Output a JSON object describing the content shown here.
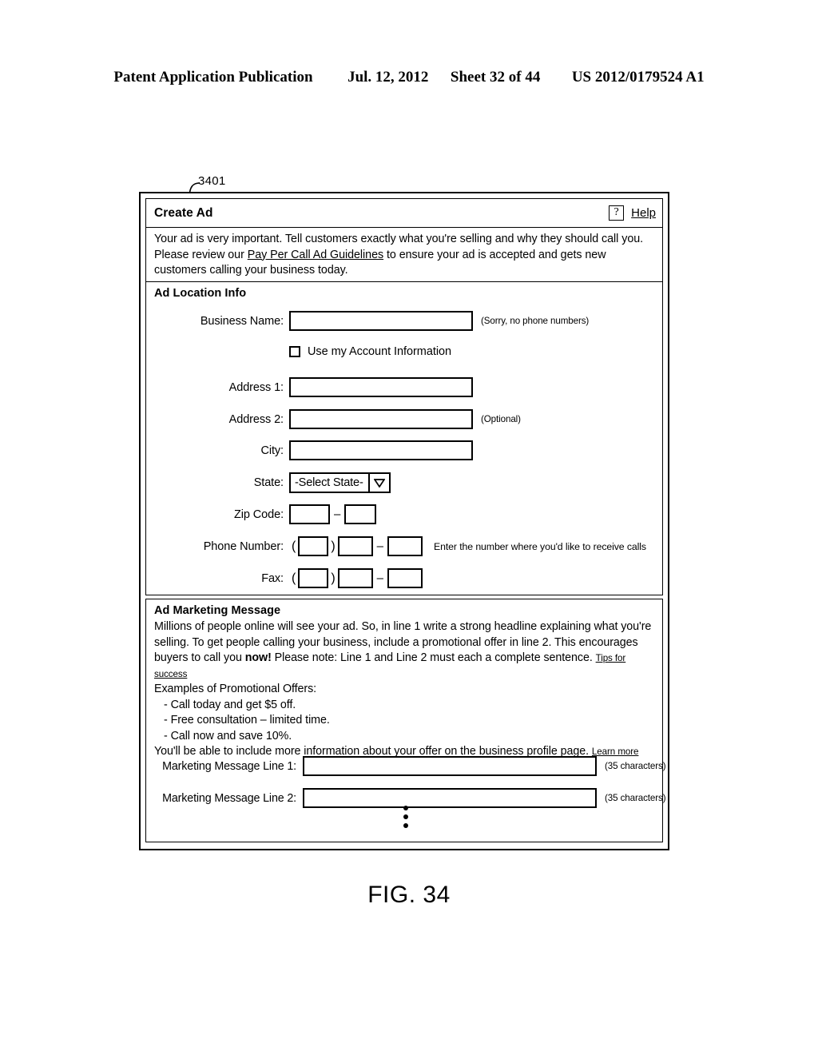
{
  "patent_header": {
    "publication": "Patent Application Publication",
    "date": "Jul. 12, 2012",
    "sheet": "Sheet 32 of 44",
    "number": "US 2012/0179524 A1"
  },
  "figure": {
    "reference_numeral": "3401",
    "caption": "FIG. 34"
  },
  "dialog": {
    "title": "Create Ad",
    "help_icon_label": "?",
    "help_link": "Help",
    "intro": {
      "part1": "Your ad is very important.  Tell customers exactly what you're selling and why they should call you.  Please review our ",
      "link": "Pay Per Call Ad Guidelines",
      "part2": " to ensure your ad is accepted and gets new customers calling your business today."
    },
    "location_section": {
      "heading": "Ad Location Info",
      "business_name_label": "Business Name:",
      "business_name_value": "",
      "business_name_hint": "(Sorry, no phone numbers)",
      "account_checkbox_label": "Use my Account Information",
      "account_checkbox_checked": false,
      "address1_label": "Address 1:",
      "address1_value": "",
      "address2_label": "Address 2:",
      "address2_value": "",
      "address2_hint": "(Optional)",
      "city_label": "City:",
      "city_value": "",
      "state_label": "State:",
      "state_selected": "-Select State-",
      "state_arrow_icon": "chevron-down-icon",
      "zip_label": "Zip Code:",
      "zip_value_1": "",
      "zip_value_2": "",
      "zip_separator": "–",
      "phone_label": "Phone Number:",
      "phone_area": "",
      "phone_prefix": "",
      "phone_line": "",
      "phone_hint": "Enter the number where you'd like to receive calls",
      "fax_label": "Fax:",
      "fax_area": "",
      "fax_prefix": "",
      "fax_line": "",
      "paren_open": "(",
      "paren_close": ")",
      "number_separator": "–"
    },
    "message_section": {
      "heading": "Ad Marketing Message",
      "body_part1": "Millions of people online will see your ad.  So, in line 1 write a strong headline explaining what you're selling.  To get people calling your business, include a promotional offer in line 2.  This encourages buyers to call you ",
      "body_bold": "now!",
      "body_part2": "  Please note: Line 1 and Line 2 must each a complete sentence. ",
      "tips_link": "Tips for success",
      "examples_heading": "Examples of Promotional Offers:",
      "examples": [
        "-  Call today and get $5 off.",
        "-  Free consultation – limited time.",
        "-  Call now and save 10%."
      ],
      "profile_note": "You'll be able to include more information about your offer on the business profile page. ",
      "learn_more_link": "Learn more",
      "line1_label": "Marketing Message Line 1:",
      "line1_value": "",
      "line1_hint": "(35 characters)",
      "line2_label": "Marketing Message Line 2:",
      "line2_value": "",
      "line2_hint": "(35 characters)",
      "continuation_icon": "vertical-ellipsis-icon"
    }
  }
}
